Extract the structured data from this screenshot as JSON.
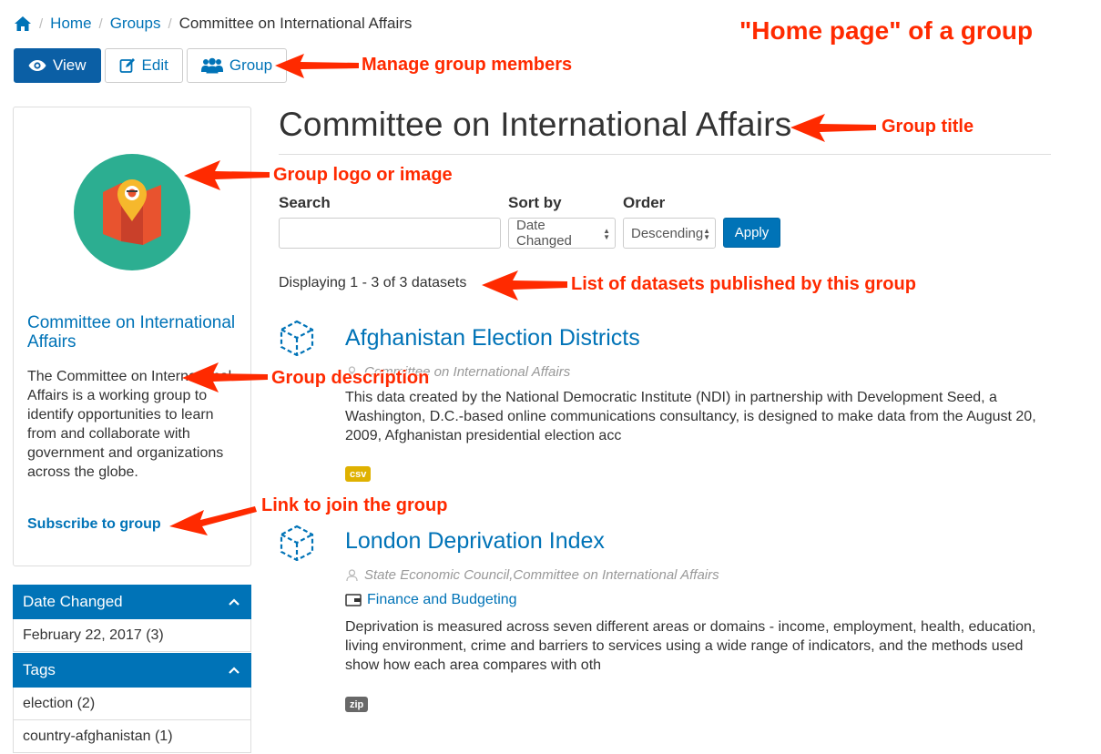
{
  "breadcrumb": {
    "home_icon": "home-icon",
    "items": [
      "Home",
      "Groups",
      "Committee on International Affairs"
    ]
  },
  "tabs": [
    {
      "label": "View",
      "icon": "eye-icon",
      "active": true
    },
    {
      "label": "Edit",
      "icon": "edit-icon",
      "active": false
    },
    {
      "label": "Group",
      "icon": "users-icon",
      "active": false
    }
  ],
  "group": {
    "name": "Committee on International Affairs",
    "logo_icon": "map-pin-icon",
    "logo_color": "#2cae91",
    "description": "The Committee on International Affairs is a working group to identify opportunities to learn from and collaborate with government and organizations across the globe.",
    "subscribe_label": "Subscribe to group"
  },
  "facets": [
    {
      "title": "Date Changed",
      "items": [
        "February 22, 2017 (3)"
      ]
    },
    {
      "title": "Tags",
      "items": [
        "election (2)",
        "country-afghanistan (1)"
      ]
    }
  ],
  "main": {
    "title": "Committee on International Affairs",
    "search_label": "Search",
    "search_value": "",
    "sort_label": "Sort by",
    "sort_value": "Date Changed",
    "order_label": "Order",
    "order_value": "Descending",
    "apply_label": "Apply",
    "count_text": "Displaying 1 - 3 of 3 datasets"
  },
  "datasets": [
    {
      "title": "Afghanistan Election Districts",
      "org": "Committee on International Affairs",
      "topic": "",
      "description": "This data created by the National Democratic Institute (NDI) in partnership with Development Seed, a Washington, D.C.-based online communications consultancy, is designed to make data from the August 20, 2009, Afghanistan presidential election acc",
      "format": "csv",
      "format_color": "#dfb100"
    },
    {
      "title": "London Deprivation Index",
      "org": "State Economic Council,Committee on International Affairs",
      "topic": "Finance and Budgeting",
      "description": "Deprivation is measured across seven different areas or domains - income, employment, health, education, living environment, crime and barriers to services using a wide range of indicators, and the methods used show how each area compares with oth",
      "format": "zip",
      "format_color": "#686868"
    }
  ],
  "annotations": {
    "home_page": "\"Home page\" of a group",
    "manage_members": "Manage group members",
    "group_title": "Group title",
    "group_logo": "Group logo or image",
    "dataset_list": "List of datasets published by this group",
    "group_description": "Group description",
    "join_link": "Link to join the group",
    "color": "#ff2a00"
  }
}
